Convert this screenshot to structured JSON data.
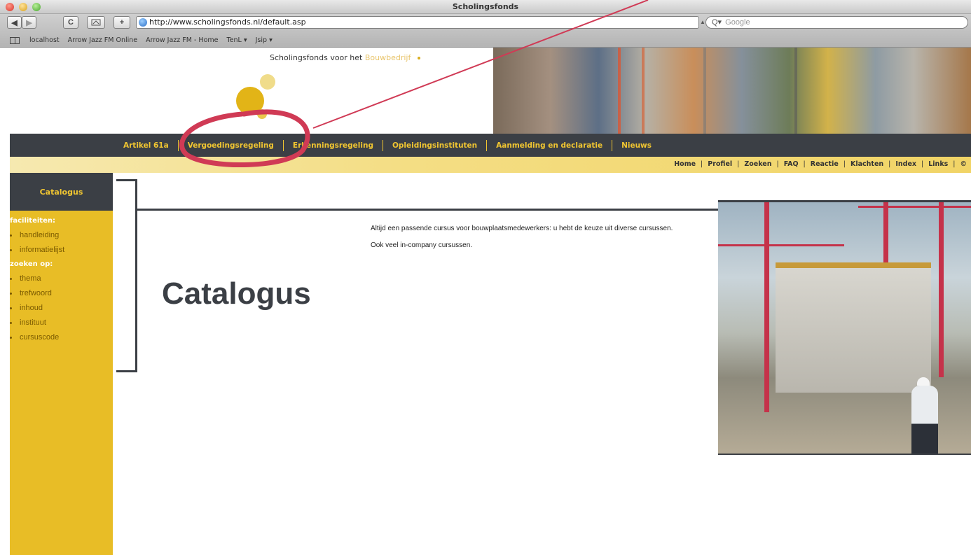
{
  "window": {
    "title": "Scholingsfonds"
  },
  "toolbar": {
    "back": "◀",
    "forward": "▶",
    "reload": "C",
    "add_bookmark": "+",
    "url": "http://www.scholingsfonds.nl/default.asp",
    "search_placeholder": "Google",
    "search_icon": "Q▾"
  },
  "bookmarks": [
    "localhost",
    "Arrow Jazz FM Online",
    "Arrow Jazz FM - Home",
    "TenL ▾",
    "Jsip ▾"
  ],
  "header": {
    "logo_text_main": "Scholingsfonds voor het ",
    "logo_text_accent": "Bouwbedrijf"
  },
  "mainnav": [
    "Artikel 61a",
    "Vergoedingsregeling",
    "Erkenningsregeling",
    "Opleidingsinstituten",
    "Aanmelding en declaratie",
    "Nieuws"
  ],
  "subnav": [
    "Home",
    "Profiel",
    "Zoeken",
    "FAQ",
    "Reactie",
    "Klachten",
    "Index",
    "Links",
    "©"
  ],
  "sidebar": {
    "title": "Catalogus",
    "group1": "faciliteiten:",
    "group1_items": [
      "handleiding",
      "informatielijst"
    ],
    "group2": "zoeken op:",
    "group2_items": [
      "thema",
      "trefwoord",
      "inhoud",
      "instituut",
      "cursuscode"
    ]
  },
  "content": {
    "title": "Catalogus",
    "para1": "Altijd een passende cursus voor bouwplaatsmedewerkers: u hebt de keuze uit diverse cursussen.",
    "para2": "Ook veel in-company cursussen."
  },
  "colors": {
    "nav_dark": "#3b3f45",
    "accent_yellow": "#e8bd26",
    "annotation_red": "#d03a55"
  }
}
